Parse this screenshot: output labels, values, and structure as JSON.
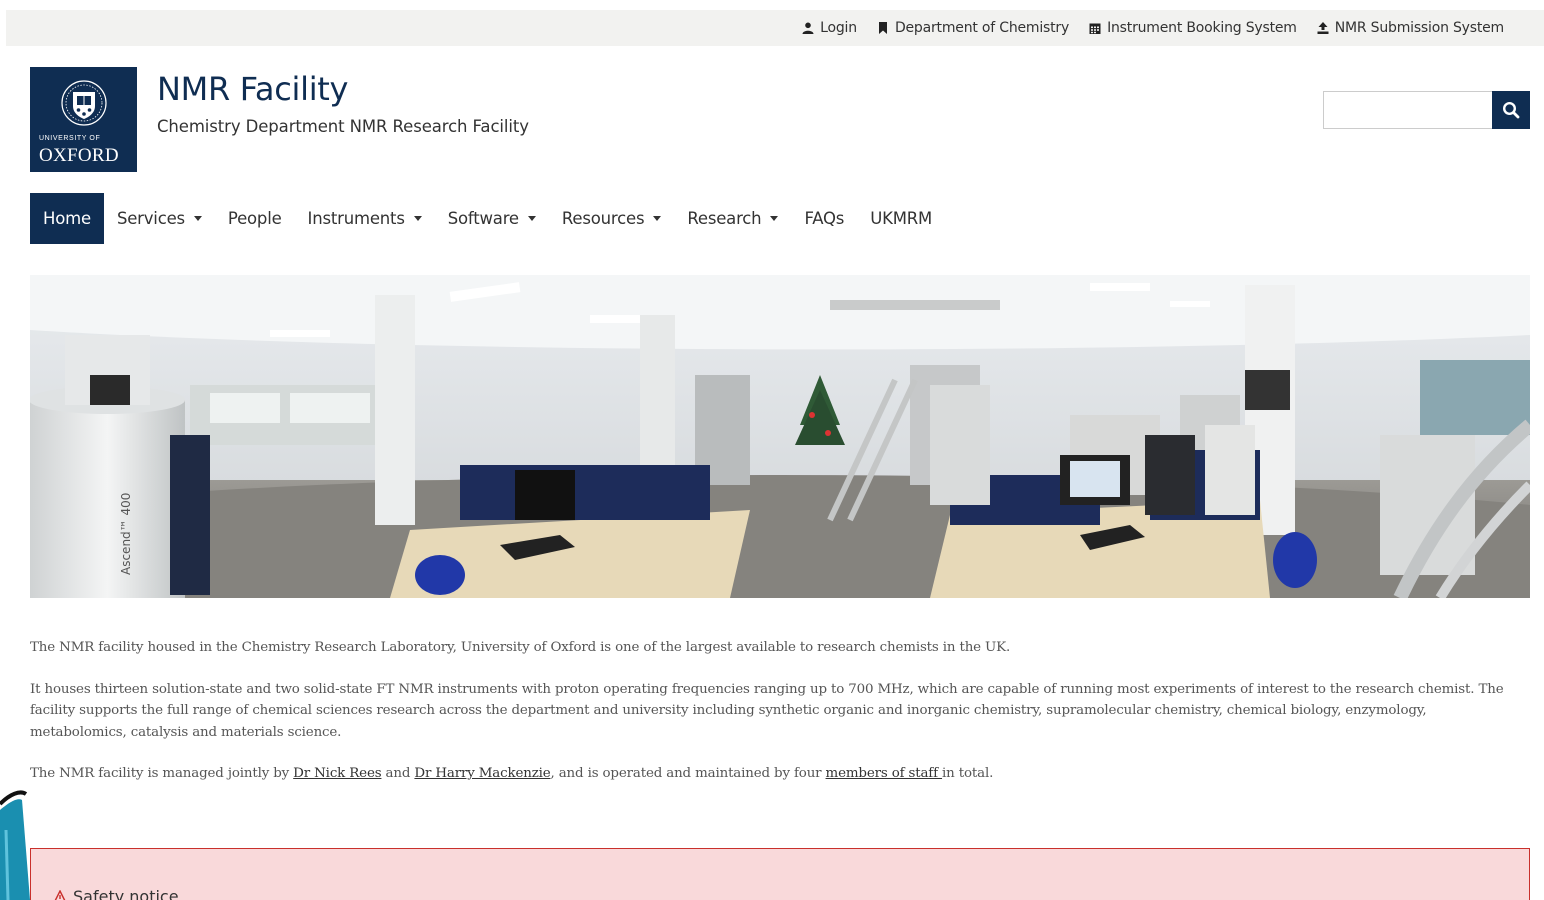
{
  "topbar": {
    "links": [
      {
        "label": "Login",
        "icon": "user-icon"
      },
      {
        "label": "Department of Chemistry",
        "icon": "bookmark-icon"
      },
      {
        "label": "Instrument Booking System",
        "icon": "calendar-icon"
      },
      {
        "label": "NMR Submission System",
        "icon": "upload-icon"
      }
    ]
  },
  "header": {
    "logo_small": "UNIVERSITY OF",
    "logo_big": "OXFORD",
    "title": "NMR Facility",
    "subtitle": "Chemistry Department NMR Research Facility",
    "search_placeholder": ""
  },
  "nav": {
    "items": [
      {
        "label": "Home",
        "dropdown": false,
        "active": true
      },
      {
        "label": "Services",
        "dropdown": true
      },
      {
        "label": "People",
        "dropdown": false
      },
      {
        "label": "Instruments",
        "dropdown": true
      },
      {
        "label": "Software",
        "dropdown": true
      },
      {
        "label": "Resources",
        "dropdown": true
      },
      {
        "label": "Research",
        "dropdown": true
      },
      {
        "label": "FAQs",
        "dropdown": false
      },
      {
        "label": "UKMRM",
        "dropdown": false
      }
    ]
  },
  "banner": {
    "magnet_label": "Ascend™ 400"
  },
  "content": {
    "p1": "The NMR facility housed in the Chemistry Research Laboratory, University of Oxford is one of the largest available to research chemists in the UK.",
    "p2": "It houses thirteen solution-state and two solid-state FT NMR instruments with proton operating frequencies ranging up to 700 MHz, which are capable of running most experiments of interest to the research chemist. The facility supports the full range of chemical sciences research across the department and university including synthetic organic and inorganic chemistry, supramolecular chemistry, chemical biology, enzymology, metabolomics, catalysis and materials science.",
    "p3_a": "The NMR facility is managed jointly by ",
    "p3_link1": "Dr Nick Rees",
    "p3_b": " and ",
    "p3_link2": "Dr Harry Mackenzie",
    "p3_c": ", and is operated and maintained by four ",
    "p3_link3": "members of staff ",
    "p3_d": "in total."
  },
  "safety": {
    "title": "Safety notice"
  },
  "colors": {
    "brand": "#0f2d52",
    "safety_bg": "#f9d9da",
    "safety_border": "#c9302c",
    "topbar_bg": "#f2f2f0"
  }
}
